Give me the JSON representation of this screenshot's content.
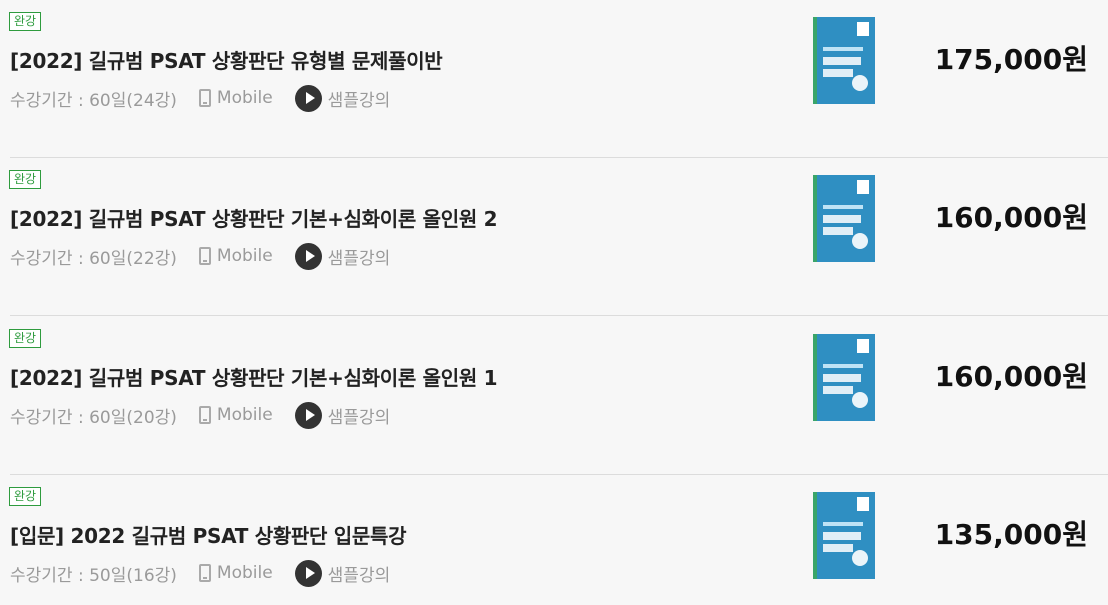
{
  "courses": [
    {
      "badge": "완강",
      "title": "[2022] 길규범 PSAT 상황판단 유형별 문제풀이반",
      "period": "수강기간 : 60일(24강)",
      "mobile": "Mobile",
      "sample": "샘플강의",
      "price": "175,000원",
      "cover_color": "#2f8fc2"
    },
    {
      "badge": "완강",
      "title": "[2022] 길규범 PSAT 상황판단 기본+심화이론 올인원 2",
      "period": "수강기간 : 60일(22강)",
      "mobile": "Mobile",
      "sample": "샘플강의",
      "price": "160,000원",
      "cover_color": "#2f8fc2"
    },
    {
      "badge": "완강",
      "title": "[2022] 길규범 PSAT 상황판단 기본+심화이론 올인원 1",
      "period": "수강기간 : 60일(20강)",
      "mobile": "Mobile",
      "sample": "샘플강의",
      "price": "160,000원",
      "cover_color": "#2f8fc2"
    },
    {
      "badge": "완강",
      "title": "[입문] 2022 길규범 PSAT 상황판단 입문특강",
      "period": "수강기간 : 50일(16강)",
      "mobile": "Mobile",
      "sample": "샘플강의",
      "price": "135,000원",
      "cover_color": "#2f8fc2"
    }
  ],
  "colors": {
    "badge": "#2e9b3e",
    "muted": "#9a9a9a",
    "background": "#f7f7f7",
    "divider": "#dcdcdc"
  },
  "icons": {
    "mobile": "phone-icon",
    "sample": "play-icon"
  }
}
